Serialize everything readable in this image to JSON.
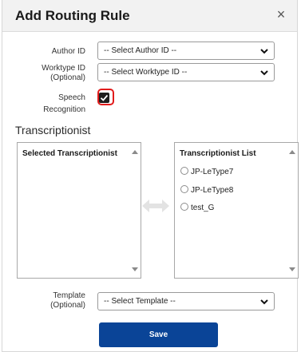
{
  "dialog": {
    "title": "Add Routing Rule",
    "close_symbol": "×"
  },
  "fields": {
    "author_id": {
      "label": "Author ID",
      "selected": "-- Select Author ID --"
    },
    "worktype_id": {
      "label_line1": "Worktype ID",
      "label_line2": "(Optional)",
      "selected": "-- Select Worktype ID --"
    },
    "speech_recognition": {
      "label_line1": "Speech",
      "label_line2": "Recognition",
      "checked": true
    },
    "template": {
      "label_line1": "Template",
      "label_line2": "(Optional)",
      "selected": "-- Select Template --"
    }
  },
  "transcriptionist": {
    "section_title": "Transcriptionist",
    "selected_header": "Selected Transcriptionist",
    "list_header": "Transcriptionist List",
    "list_items": [
      {
        "label": "JP-LeType7"
      },
      {
        "label": "JP-LeType8"
      },
      {
        "label": "test_G"
      }
    ]
  },
  "actions": {
    "save_label": "Save"
  },
  "colors": {
    "primary_button": "#0a4497",
    "highlight": "#e11b1b",
    "header_bg": "#f2f2f2"
  },
  "icons": [
    "close-icon",
    "chevron-down-icon",
    "checkmark-icon",
    "transfer-arrows-icon",
    "scroll-up-icon",
    "scroll-down-icon"
  ]
}
